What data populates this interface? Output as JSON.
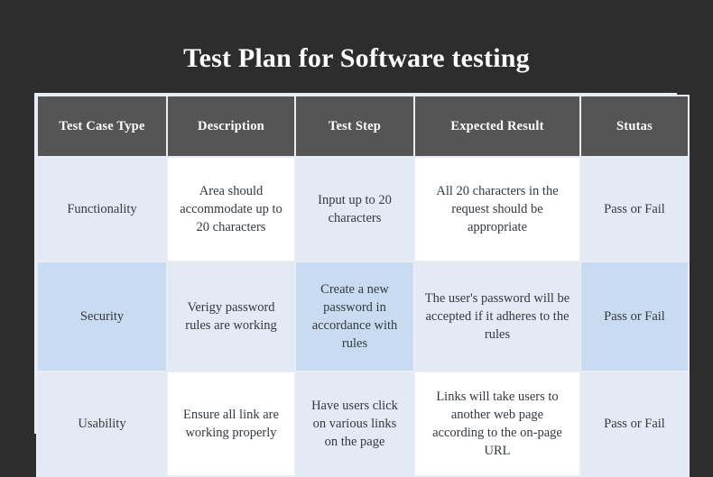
{
  "page": {
    "background_color": "#2d2d2d",
    "title": "Test Plan for Software testing"
  },
  "table": {
    "border_color": "#e8ecf4",
    "header_background": "#555555",
    "header_text_color": "#ffffff",
    "body_text_color": "#333a40",
    "cell_tints": {
      "light_blue": "#e4eaf4",
      "white": "#ffffff",
      "medium_blue": "#c9dbf0"
    },
    "columns": [
      "Test Case Type",
      "Description",
      "Test Step",
      "Expected Result",
      "Stutas"
    ],
    "rows": [
      {
        "test_case_type": "Functionality",
        "description": "Area should accommodate up to 20 characters",
        "test_step": "Input up to 20 characters",
        "expected_result": "All 20 characters in the request should be appropriate",
        "status": "Pass or Fail"
      },
      {
        "test_case_type": "Security",
        "description": "Verigy password rules are working",
        "test_step": "Create a new password in accordance with rules",
        "expected_result": "The user's password will be accepted if it adheres to the rules",
        "status": "Pass or Fail"
      },
      {
        "test_case_type": "Usability",
        "description": "Ensure all link are working properly",
        "test_step": "Have users click on various links on the page",
        "expected_result": "Links will take users to another web page according to the on-page URL",
        "status": "Pass or Fail"
      }
    ]
  }
}
